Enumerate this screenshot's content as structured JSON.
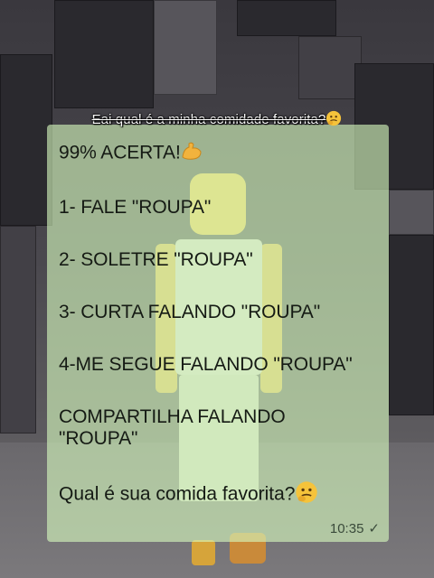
{
  "caption": {
    "text": "Eai qual é a minha comidade favorita?"
  },
  "message": {
    "intro": "99% ACERTA!",
    "step1": "1- FALE \"ROUPA\"",
    "step2": "2- SOLETRE \"ROUPA\"",
    "step3": "3- CURTA FALANDO \"ROUPA\"",
    "step4": "4-ME SEGUE FALANDO \"ROUPA\"",
    "share_line1": "COMPARTILHA FALANDO",
    "share_line2": "\"ROUPA\"",
    "question": "Qual é sua comida favorita?",
    "time": "10:35"
  },
  "icons": {
    "caption_emoji": "thinking-face-icon",
    "flex_emoji": "flexed-biceps-icon",
    "question_emoji": "thinking-face-icon",
    "read_status": "checkmark-icon"
  },
  "colors": {
    "bubble": "#d6fabe",
    "text": "#151a14",
    "caption": "#ffffff"
  }
}
